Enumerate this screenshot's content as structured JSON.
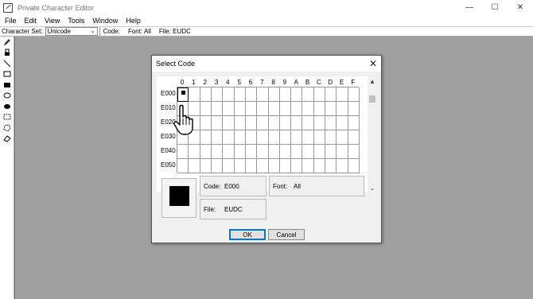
{
  "window": {
    "title": "Private Character Editor",
    "controls": [
      "—",
      "☐",
      "✕"
    ]
  },
  "menu": [
    "File",
    "Edit",
    "View",
    "Tools",
    "Window",
    "Help"
  ],
  "toolbar": {
    "charset_label": "Character Set:",
    "charset_value": "Unicode",
    "code_label": "Code:",
    "font_label": "Font: All",
    "file_label": "File: EUDC"
  },
  "tools": [
    "pencil-icon",
    "brush-icon",
    "line-icon",
    "hollow-rectangle-icon",
    "filled-rectangle-icon",
    "hollow-ellipse-icon",
    "filled-ellipse-icon",
    "rectangular-selection-icon",
    "freeform-selection-icon",
    "eraser-icon"
  ],
  "dialog": {
    "title": "Select Code",
    "close_label": "✕",
    "columns": [
      "0",
      "1",
      "2",
      "3",
      "4",
      "5",
      "6",
      "7",
      "8",
      "9",
      "A",
      "B",
      "C",
      "D",
      "E",
      "F"
    ],
    "rows": [
      "E000",
      "E010",
      "E020",
      "E030",
      "E040",
      "E050"
    ],
    "selected_cell": {
      "row": 0,
      "col": 0
    },
    "code_label": "Code:",
    "code_value": "E000",
    "font_label": "Font:",
    "font_value": "All",
    "file_label": "File:",
    "file_value": "EUDC",
    "ok_label": "OK",
    "cancel_label": "Cancel"
  }
}
